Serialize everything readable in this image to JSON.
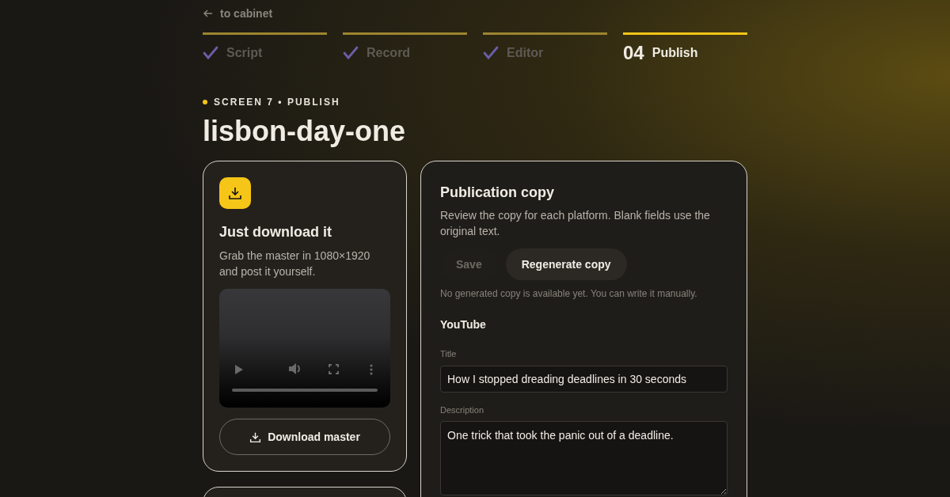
{
  "back_link": {
    "label": "to cabinet"
  },
  "steps": [
    {
      "label": "Script",
      "done": true,
      "selected": false
    },
    {
      "label": "Record",
      "done": true,
      "selected": false
    },
    {
      "label": "Editor",
      "done": true,
      "selected": false
    },
    {
      "label": "Publish",
      "number": "04",
      "done": false,
      "selected": true
    }
  ],
  "eyebrow": "SCREEN 7 • PUBLISH",
  "title": "lisbon-day-one",
  "download_card": {
    "title": "Just download it",
    "text": "Grab the master in 1080×1920 and post it yourself.",
    "button": "Download master"
  },
  "copy_card": {
    "title": "Publication copy",
    "text": "Review the copy for each platform. Blank fields use the original text.",
    "buttons": [
      {
        "label": "Save",
        "disabled": true
      },
      {
        "label": "Regenerate copy",
        "disabled": false
      }
    ],
    "note": "No generated copy is available yet. You can write it manually.",
    "platform": "YouTube",
    "fields": [
      {
        "kind": "input",
        "label": "Title",
        "value": "How I stopped dreading deadlines in 30 seconds"
      },
      {
        "kind": "textarea",
        "label": "Description",
        "value": "One trick that took the panic out of a deadline."
      }
    ]
  }
}
